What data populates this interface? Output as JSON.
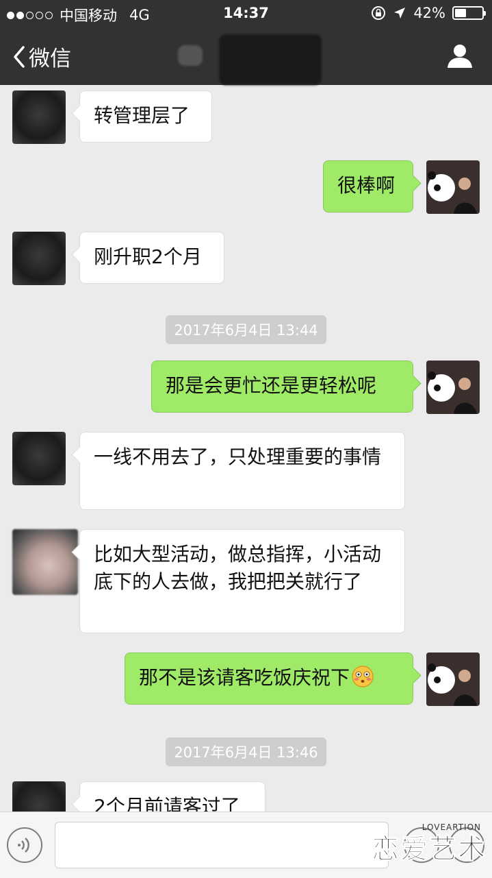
{
  "status_bar": {
    "carrier": "中国移动",
    "network": "4G",
    "time": "14:37",
    "battery": "42%",
    "battery_level": 0.42
  },
  "nav": {
    "back_label": "微信"
  },
  "messages": [
    {
      "side": "left",
      "text": "转管理层了"
    },
    {
      "side": "right",
      "text": "很棒啊"
    },
    {
      "side": "left",
      "text": "刚升职2个月"
    },
    {
      "timestamp": "2017年6月4日 13:44"
    },
    {
      "side": "right",
      "text": "那是会更忙还是更轻松呢"
    },
    {
      "side": "left",
      "text": "一线不用去了，只处理重要的事情"
    },
    {
      "side": "left",
      "text": "比如大型活动，做总指挥，小活动底下的人去做，我把把关就行了"
    },
    {
      "side": "right",
      "text": "那不是该请客吃饭庆祝下",
      "emoji": "blush-face-icon"
    },
    {
      "timestamp": "2017年6月4日 13:46"
    },
    {
      "side": "left",
      "text": "2个月前请客过了"
    }
  ],
  "watermark": {
    "brand": "恋爱艺术",
    "brand_en": "LOVEARTION"
  }
}
